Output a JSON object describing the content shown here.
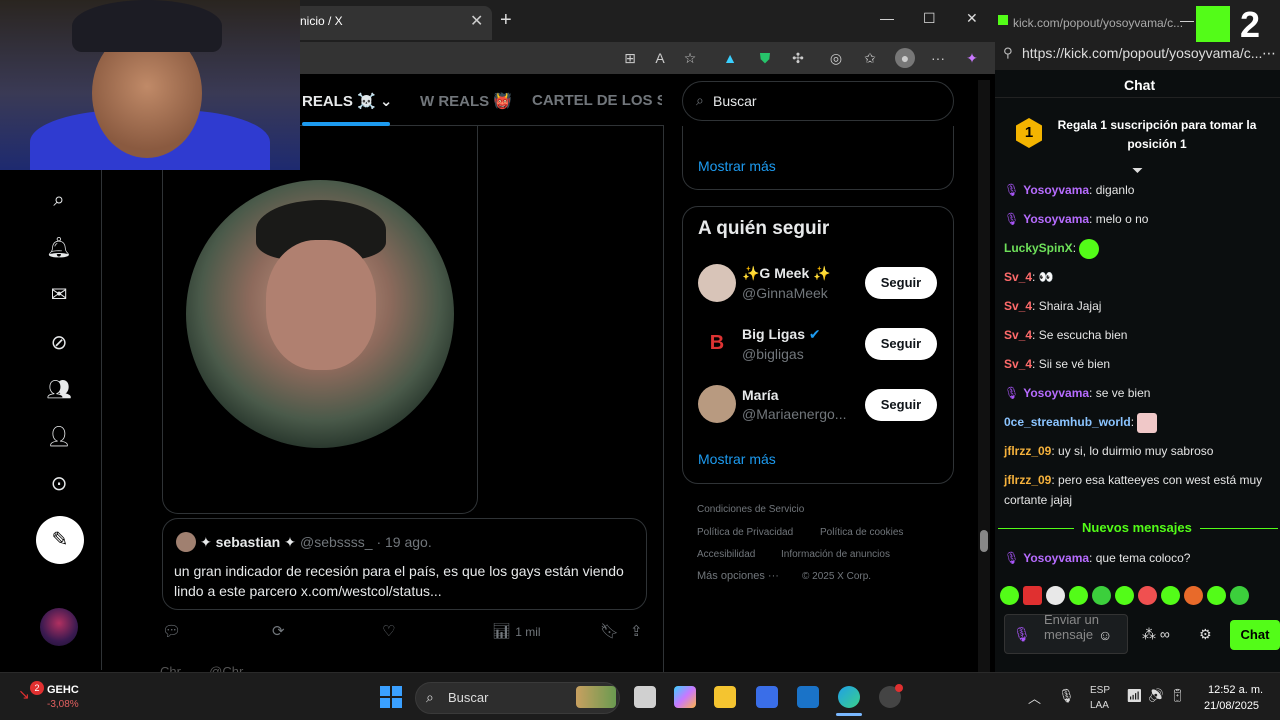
{
  "x_browser": {
    "tab_title": "nicio / X",
    "feed_tabs": [
      "REALS ☠️",
      "W REALS 👹",
      "CARTEL DE LOS SAP"
    ],
    "tab_chevron": "⌄"
  },
  "quote": {
    "name": "✦ sebastian ✦",
    "handle": "@sebssss_ · 19 ago.",
    "text": "un gran indicador de recesión para el país, es que los gays están viendo lindo a este parcero x.com/westcol/status..."
  },
  "actions": {
    "views": "1 mil"
  },
  "next_post_peek": "Chr... ... @Chr... ...",
  "right": {
    "search_placeholder": "Buscar",
    "trend_show_more": "Mostrar más",
    "who_to_follow_title": "A quién seguir",
    "suggestions": [
      {
        "name": "✨G Meek ✨",
        "handle": "@GinnaMeek",
        "button": "Seguir"
      },
      {
        "name": "Big Ligas",
        "handle": "@bigligas",
        "button": "Seguir"
      },
      {
        "name": "María",
        "handle": "@Mariaenergo...",
        "button": "Seguir"
      }
    ],
    "wts_show_more": "Mostrar más",
    "footer": [
      "Condiciones de Servicio",
      "Política de Privacidad",
      "Política de cookies",
      "Accesibilidad",
      "Información de anuncios",
      "Más opciones ···",
      "© 2025 X Corp."
    ]
  },
  "kick": {
    "tab_title": "kick.com/popout/yosoyvama/c...",
    "url": "https://kick.com/popout/yosoyvama/c...",
    "overlay_number": "2",
    "chat_title": "Chat",
    "pin_badge": "1",
    "pin_text": "Regala 1 suscripción para tomar la posición 1",
    "messages": [
      {
        "user": "Yosoyvama",
        "text": "diganlo"
      },
      {
        "user": "Yosoyvama",
        "text": "melo o no"
      },
      {
        "user": "LuckySpinX",
        "text": ""
      },
      {
        "user": "Sv_4",
        "text": "👀"
      },
      {
        "user": "Sv_4",
        "text": "Shaira Jajaj"
      },
      {
        "user": "Sv_4",
        "text": "Se escucha bien"
      },
      {
        "user": "Sv_4",
        "text": "Sii se vé bien"
      },
      {
        "user": "Yosoyvama",
        "text": "se ve bien"
      },
      {
        "user": "0ce_streamhub_world",
        "text": ""
      },
      {
        "user": "jflrzz_09",
        "text": "uy si, lo duirmio muy sabroso"
      },
      {
        "user": "jflrzz_09",
        "text": "pero esa katteeyes con west está muy cortante jajaj"
      },
      {
        "user": "Yosoyvama",
        "text": "que tema coloco?"
      }
    ],
    "new_messages_label": "Nuevos mensajes",
    "input_placeholder": "Enviar un mensaje",
    "chat_button": "Chat"
  },
  "taskbar": {
    "stock_name": "GEHC",
    "stock_change": "-3,08%",
    "stock_badge": "2",
    "search_label": "Buscar",
    "lang_1": "ESP",
    "lang_2": "LAA",
    "time": "12:52 a. m.",
    "date": "21/08/2025"
  },
  "colors": {
    "x_accent": "#1d9bf0",
    "kick_green": "#53fc18",
    "username_purple": "#b76cff"
  }
}
